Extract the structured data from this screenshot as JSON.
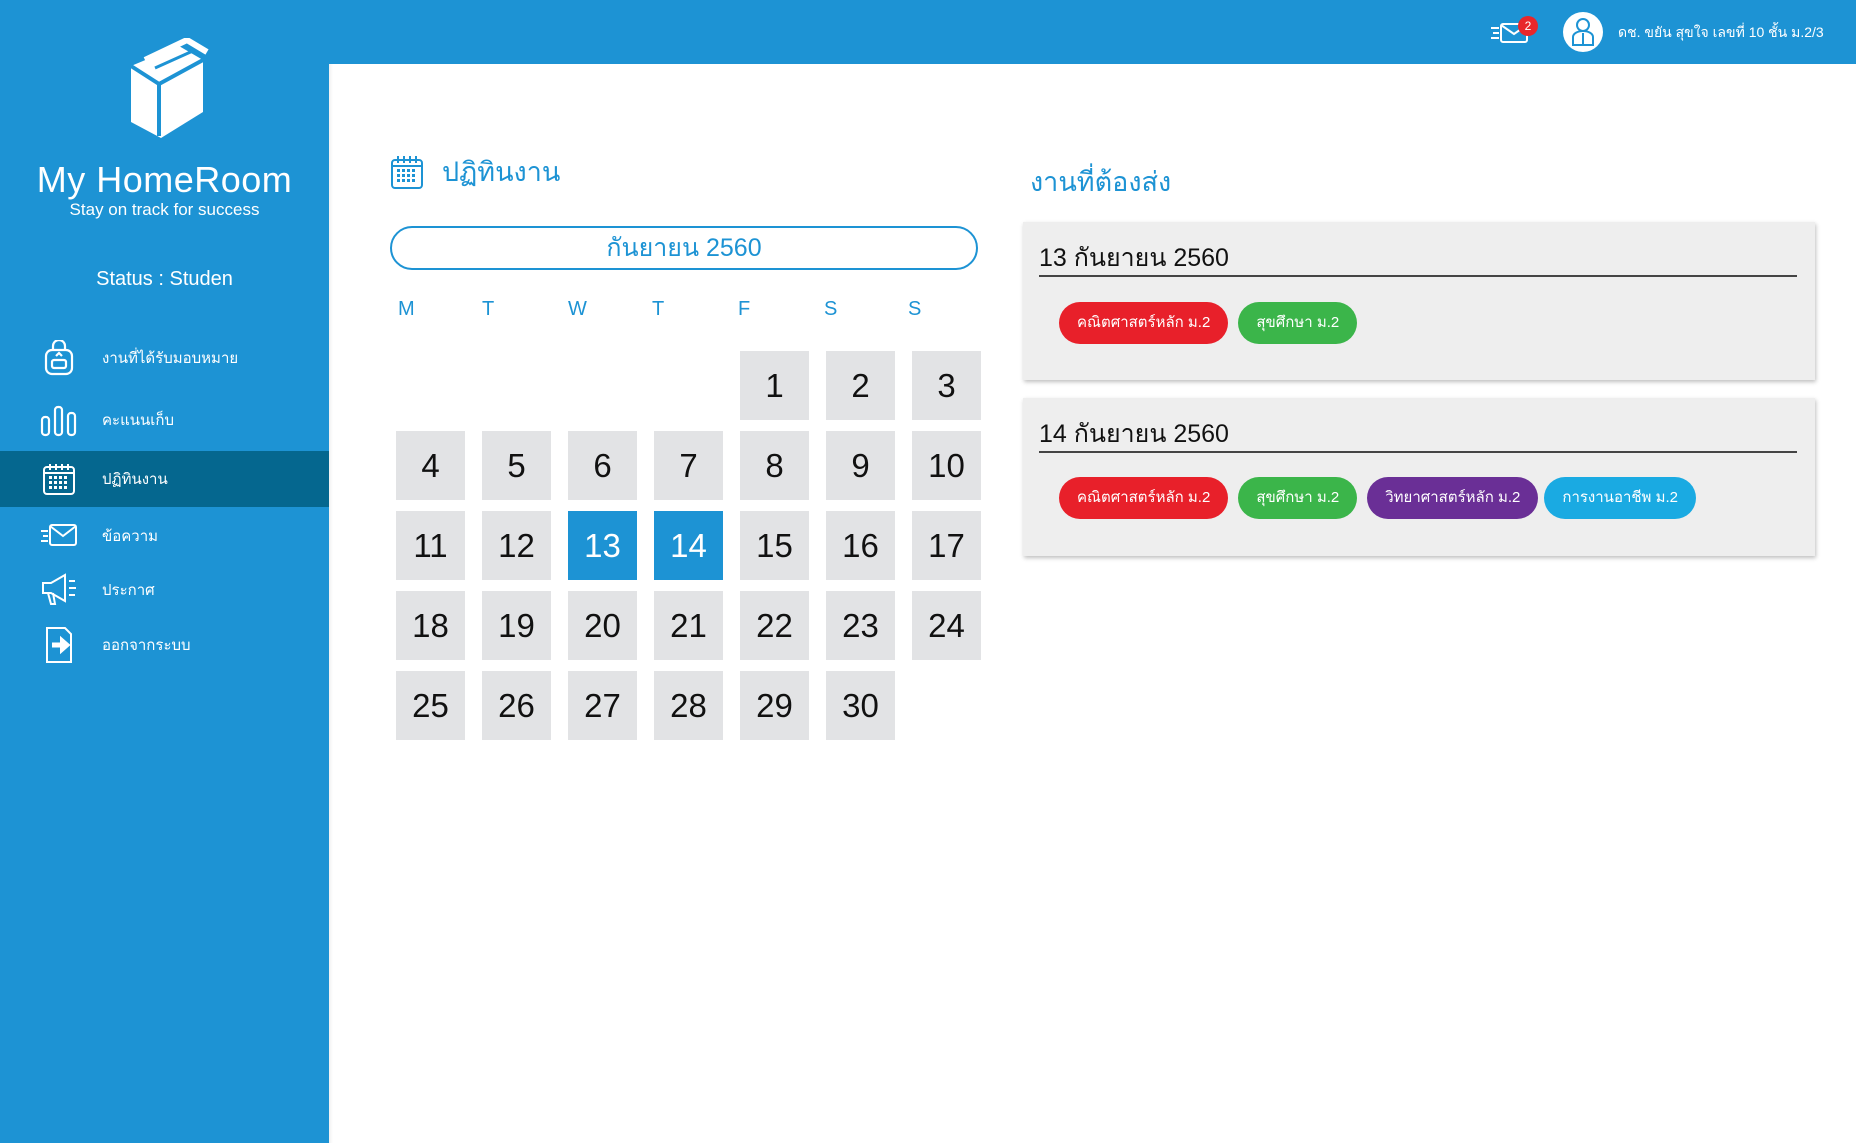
{
  "app": {
    "title": "My HomeRoom",
    "tagline": "Stay on track for success",
    "status": "Status : Studen"
  },
  "sidebar": {
    "items": [
      {
        "label": "งานที่ได้รับมอบหมาย",
        "icon": "backpack-icon",
        "active": false
      },
      {
        "label": "คะแนนเก็บ",
        "icon": "bar-chart-icon",
        "active": false
      },
      {
        "label": "ปฏิทินงาน",
        "icon": "calendar-icon",
        "active": true
      },
      {
        "label": "ข้อความ",
        "icon": "mail-icon",
        "active": false
      },
      {
        "label": "ประกาศ",
        "icon": "megaphone-icon",
        "active": false
      },
      {
        "label": "ออกจากระบบ",
        "icon": "logout-icon",
        "active": false
      }
    ]
  },
  "topbar": {
    "mail_badge": "2",
    "user_name": "ดช. ขยัน สุขใจ เลขที่ 10 ชั้น ม.2/3"
  },
  "calendar": {
    "title": "ปฏิทินงาน",
    "month": "กันยายน 2560",
    "weekdays": [
      "M",
      "T",
      "W",
      "T",
      "F",
      "S",
      "S"
    ],
    "first_weekday_index": 4,
    "days_in_month": 30,
    "selected_days": [
      13,
      14
    ]
  },
  "tasks": {
    "title": "งานที่ต้องส่ง",
    "groups": [
      {
        "date": "13 กันยายน 2560",
        "items": [
          {
            "label": "คณิตศาสตร์หลัก ม.2",
            "color": "#e8202a"
          },
          {
            "label": "สุขศึกษา ม.2",
            "color": "#3bb54a"
          }
        ]
      },
      {
        "date": "14 กันยายน 2560",
        "items": [
          {
            "label": "คณิตศาสตร์หลัก ม.2",
            "color": "#e8202a"
          },
          {
            "label": "สุขศึกษา ม.2",
            "color": "#3bb54a"
          },
          {
            "label": "วิทยาศาสตร์หลัก ม.2",
            "color": "#6a2f96"
          },
          {
            "label": "การงานอาชีพ ม.2",
            "color": "#1aaae2"
          }
        ]
      }
    ]
  },
  "colors": {
    "primary": "#1d93d4",
    "sidebar_active": "#05678f",
    "day_bg": "#e2e3e5",
    "badge": "#e8262b"
  }
}
